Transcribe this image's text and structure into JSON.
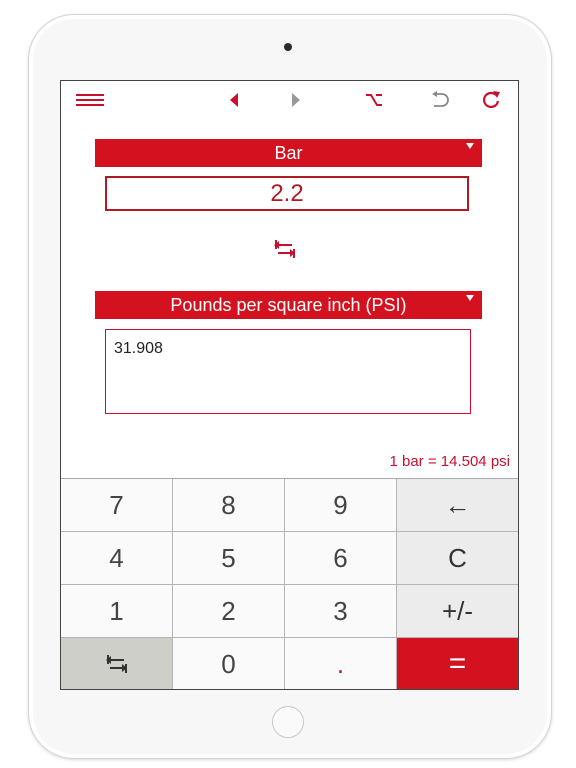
{
  "toolbar": {
    "menu_icon": "hamburger-icon",
    "back_icon": "triangle-left-icon",
    "forward_icon": "triangle-right-icon",
    "option_icon": "option-key-icon",
    "undo_icon": "undo-icon",
    "reset_icon": "refresh-icon"
  },
  "from": {
    "unit": "Bar",
    "value": "2.2"
  },
  "swap_icon": "swap-arrows-icon",
  "to": {
    "unit": "Pounds per square inch (PSI)",
    "value": "31.908"
  },
  "rate": "1 bar = 14.504 psi",
  "keypad": {
    "k7": "7",
    "k8": "8",
    "k9": "9",
    "backspace": "←",
    "k4": "4",
    "k5": "5",
    "k6": "6",
    "clear": "C",
    "k1": "1",
    "k2": "2",
    "k3": "3",
    "plusminus": "+/-",
    "swap": "⇆",
    "k0": "0",
    "dot": ".",
    "equals": "="
  },
  "colors": {
    "accent": "#d4121f",
    "key_bg": "#fafafa",
    "key_gray": "#ececec",
    "key_swap": "#cfcfca"
  }
}
